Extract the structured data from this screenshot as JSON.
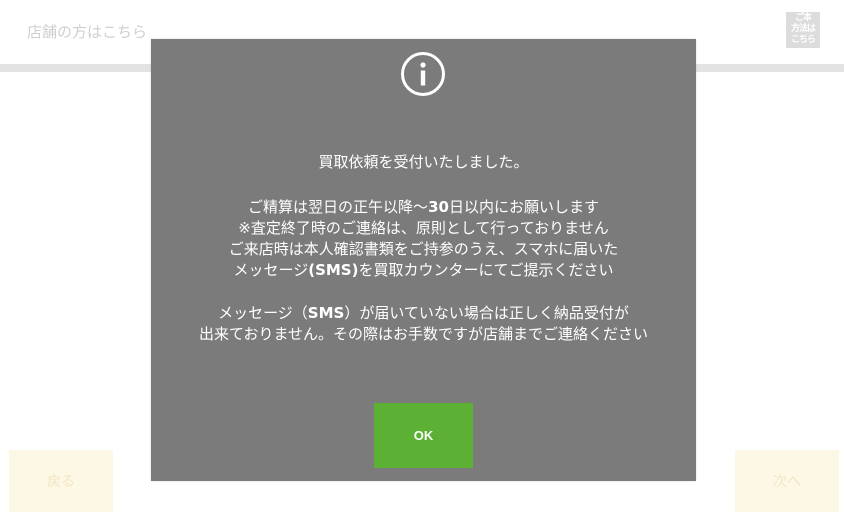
{
  "header": {
    "store_link": "店舗の方はこちら",
    "store_icon_text": "ご本人\n方法は\nこちら"
  },
  "footer": {
    "back_label": "戻る",
    "next_label": "次へ"
  },
  "dialog": {
    "icon": "info-circle-icon",
    "line_1": "買取依頼を受付いたしました。",
    "line_2_pre": "ご精算は翌日の正午以降〜",
    "line_2_bold": "30",
    "line_2_post": "日以内にお願いします",
    "line_3": "※査定終了時のご連絡は、原則として行っておりません",
    "line_4": "ご来店時は本人確認書類をご持参のうえ、スマホに届いた",
    "line_5_pre": "メッセージ",
    "line_5_bold": "(SMS)",
    "line_5_post": "を買取カウンターにてご提示ください",
    "line_6_pre": "メッセージ（",
    "line_6_bold": "SMS",
    "line_6_post": "）が届いていない場合は正しく納品受付が",
    "line_7": "出来ておりません。その際はお手数ですが店舗までご連絡ください",
    "ok_label": "OK"
  },
  "colors": {
    "modal_bg": "#7b7b7b",
    "ok_button": "#5cb034",
    "text": "#ffffff"
  }
}
